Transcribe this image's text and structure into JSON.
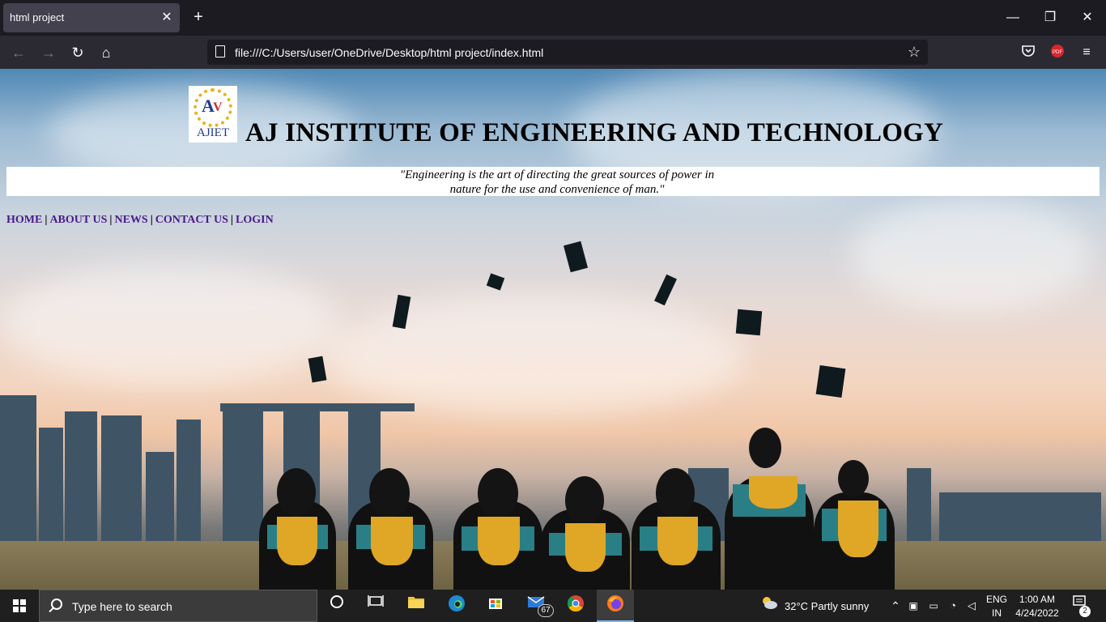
{
  "browser": {
    "tab_title": "html project",
    "tab_close": "✕",
    "new_tab": "+",
    "url": "file:///C:/Users/user/OneDrive/Desktop/html project/index.html",
    "window_controls": [
      "—",
      "❐",
      "✕"
    ]
  },
  "site": {
    "logo_text": "AJIET",
    "title": "AJ INSTITUTE OF ENGINEERING AND TECHNOLOGY",
    "quote": "\"Engineering is the art of directing the great sources of power in nature for the use and convenience of man.\"",
    "nav": [
      {
        "label": "HOME"
      },
      {
        "label": "ABOUT US"
      },
      {
        "label": "NEWS"
      },
      {
        "label": "CONTACT US"
      },
      {
        "label": "LOGIN"
      }
    ],
    "nav_separator": "|"
  },
  "taskbar": {
    "search_placeholder": "Type here to search",
    "mail_badge": "67",
    "weather": "32°C  Partly sunny",
    "lang_top": "ENG",
    "lang_bottom": "IN",
    "time": "1:00 AM",
    "date": "4/24/2022",
    "notifications": "2"
  },
  "colors": {
    "nav_link": "#4b1a8a",
    "logo_gold": "#e6b11b",
    "logo_blue": "#203a8f"
  }
}
